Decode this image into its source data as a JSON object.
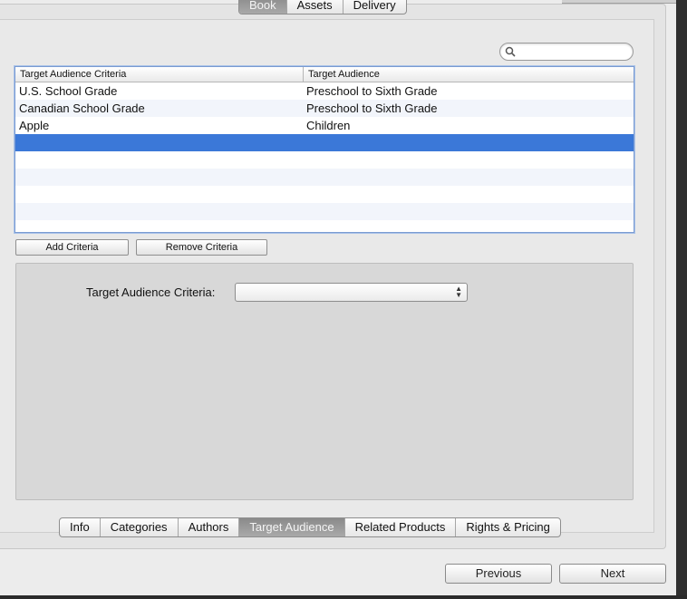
{
  "top_tabs": [
    {
      "label": "Book",
      "selected": true
    },
    {
      "label": "Assets",
      "selected": false
    },
    {
      "label": "Delivery",
      "selected": false
    }
  ],
  "search": {
    "value": "",
    "placeholder": ""
  },
  "table": {
    "columns": [
      "Target Audience Criteria",
      "Target Audience"
    ],
    "rows": [
      [
        "U.S. School Grade",
        "Preschool to Sixth Grade"
      ],
      [
        "Canadian School Grade",
        "Preschool to Sixth Grade"
      ],
      [
        "Apple",
        "Children"
      ],
      [
        "",
        ""
      ]
    ],
    "selected_row": 3
  },
  "buttons": {
    "add": "Add Criteria",
    "remove": "Remove Criteria"
  },
  "detail": {
    "criteria_label": "Target Audience Criteria:",
    "criteria_value": ""
  },
  "bottom_tabs": [
    {
      "label": "Info",
      "selected": false
    },
    {
      "label": "Categories",
      "selected": false
    },
    {
      "label": "Authors",
      "selected": false
    },
    {
      "label": "Target Audience",
      "selected": true
    },
    {
      "label": "Related Products",
      "selected": false
    },
    {
      "label": "Rights & Pricing",
      "selected": false
    }
  ],
  "nav": {
    "previous": "Previous",
    "next": "Next"
  },
  "colors": {
    "selection": "#3b78d8",
    "selected_tab": "#9a9a9a"
  }
}
